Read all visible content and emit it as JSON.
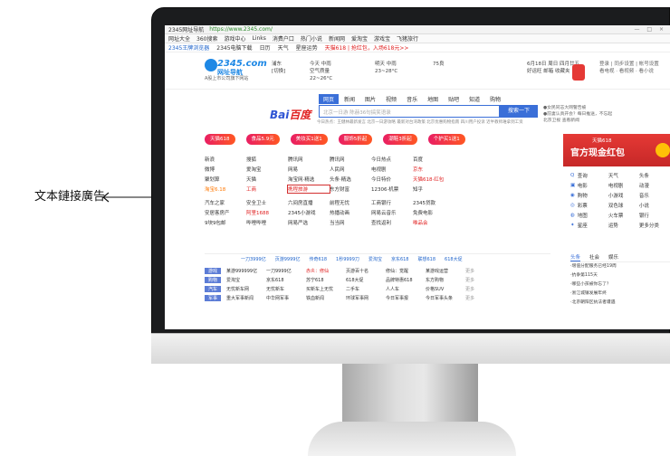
{
  "annotation": {
    "label": "文本鏈接廣告"
  },
  "browser": {
    "tab_title": "2345网址导航",
    "url": "https://www.2345.com/",
    "bookmarks": [
      "网址大全",
      "360搜索",
      "游戏中心",
      "Links",
      "消费户口",
      "热门小说",
      "新闻网",
      "爱淘宝",
      "游戏宝",
      "飞猪旅行"
    ],
    "sub_links": [
      "2345王牌浏览器",
      "2345电脑下载",
      "日历",
      "天气",
      "星座运势"
    ],
    "sub_promo": "天猫618 | 抢红包，入场618元>>"
  },
  "header": {
    "logo_main": "2345.com",
    "logo_sub": "网址导航",
    "logo_tagline": "A股上市公司旗下网站",
    "city": "浦东",
    "city_switch": "[切换]",
    "weather_today": "今天 中雨",
    "weather_today_note": "空气质量",
    "temp_today": "22~26°C",
    "weather_tomorrow": "明天 中雨",
    "temp_tomorrow": "23~28°C",
    "aqi": "75良",
    "date_line": "6月18日 周日 四月廿五",
    "date_links": [
      "好运旺",
      "邮箱",
      "收藏夹"
    ],
    "right_line1": "登录 | 同步设置 | 帐号设置",
    "right_line2": "看电视 · 看视频 · 看小说"
  },
  "search": {
    "tabs": [
      "网页",
      "新闻",
      "图片",
      "视频",
      "音乐",
      "地图",
      "贴吧",
      "知道",
      "购物"
    ],
    "active_tab": "网页",
    "engine_a": "Bai",
    "engine_b": "百度",
    "placeholder": "北京一日游 陈赫36句搞笑语录",
    "button": "搜索一下",
    "hot": "今日热点：王健林最新发言  北京一日游攻略  最新对台湾政策  北京优惠购物指南  四川用户投诉  近半教师难拿到工资",
    "right1": "●女民同志大网警告被",
    "right2": "●前妻认真开会？每日推送，不忘起",
    "right3": "北京卫视 查看新闻"
  },
  "pills": [
    "天猫618",
    "食品5.9元",
    "美妆买1送1",
    "服饰5折起",
    "潮鞋3折起",
    "个护买1送1"
  ],
  "links_grid": [
    [
      "新浪",
      "搜狐",
      "腾讯网",
      "腾讯网",
      "今日热点",
      "百度"
    ],
    [
      "微博",
      "爱淘宝",
      "网易",
      "人民网",
      "电视剧",
      "京东"
    ],
    [
      "聚划算",
      "天猫",
      "淘宝网·精选",
      "头条·精选",
      "今日特价",
      "天猫618·红包"
    ],
    [
      "淘宝6.18",
      "工商",
      "淘宝网·新闻",
      "东方财富",
      "12306·机票",
      "知乎"
    ],
    [
      "汽车之家",
      "安全卫士",
      "六间房直播",
      "前程无忧",
      "工商银行",
      "2345贷款"
    ],
    [
      "安居客房产",
      "阿里1688",
      "2345小游戏",
      "热播动画",
      "网易云音乐",
      "免费电影"
    ],
    [
      "9块9包邮",
      "哔哩哔哩",
      "网易严选",
      "当当网",
      "查找返利",
      "唯品会"
    ]
  ],
  "highlighted_link": "携程旅游",
  "strip": [
    "一刀3999亿",
    "页游9999亿",
    "传奇618",
    "1秒9999刀",
    "爱淘宝",
    "京东618",
    "联想618",
    "618大促"
  ],
  "categories": [
    {
      "label": "游戏",
      "items": [
        "某游999999亿",
        "一刀9999亿",
        "赤炎：修仙",
        "页游百十名",
        "修仙：觉醒",
        "某游戏运营"
      ],
      "more": "更多"
    },
    {
      "label": "购物",
      "items": [
        "爱淘宝",
        "京东618",
        "苏宁618",
        "618大促",
        "品牌特惠618",
        "东方购物"
      ],
      "more": "更多"
    },
    {
      "label": "汽车",
      "items": [
        "无忧新车网",
        "无忧新车",
        "买新车上无忧",
        "二手车",
        "人人车",
        "价格SUV"
      ],
      "more": "更多"
    },
    {
      "label": "军事",
      "items": [
        "重大军事新闻",
        "中华网军事",
        "铁血新闻",
        "环球军事网",
        "今日军事报",
        "今日军事头条"
      ],
      "more": "更多"
    }
  ],
  "ad": {
    "small": "天猫618",
    "big": "官方现金红包"
  },
  "services": [
    [
      "查询",
      "天气",
      "头条"
    ],
    [
      "电影",
      "电视剧",
      "动漫"
    ],
    [
      "购物",
      "小游戏",
      "音乐"
    ],
    [
      "彩票",
      "双色球",
      "小说"
    ],
    [
      "地图",
      "火车票",
      "银行"
    ],
    [
      "星座",
      "运势",
      "更多分类"
    ]
  ],
  "news": {
    "tabs": [
      "头条",
      "社会",
      "娱乐"
    ],
    "items": [
      "·增值分配服务已经19周",
      "·抗争第115天",
      "·哪些小孩被你忘了？",
      "·浙江城镇发展年终",
      "·北京朝阳区执法者遭遇"
    ]
  }
}
